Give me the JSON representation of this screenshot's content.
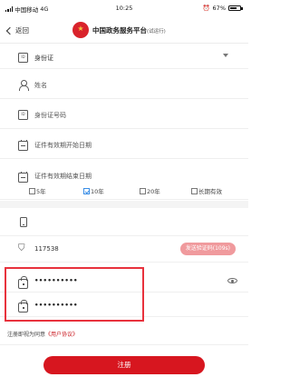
{
  "status_bar": {
    "carrier": "中国移动",
    "network": "4G",
    "time": "10:25",
    "battery": "67%"
  },
  "nav": {
    "back_label": "返回",
    "title": "中国政务服务平台",
    "title_suffix": "(试运行)"
  },
  "form": {
    "id_type": {
      "value": "身份证",
      "icon": "id-card-icon"
    },
    "name": {
      "placeholder": "姓名",
      "icon": "person-icon"
    },
    "id_number": {
      "placeholder": "身份证号码",
      "icon": "id-card-icon"
    },
    "valid_start": {
      "placeholder": "证件有效期开始日期",
      "icon": "calendar-icon"
    },
    "valid_end": {
      "placeholder": "证件有效期结束日期",
      "icon": "calendar-icon"
    },
    "validity_options": [
      {
        "label": "5年",
        "checked": false
      },
      {
        "label": "10年",
        "checked": true
      },
      {
        "label": "20年",
        "checked": false
      },
      {
        "label": "长期有效",
        "checked": false
      }
    ],
    "phone": {
      "placeholder": "",
      "icon": "phone-icon"
    },
    "sms_code": {
      "value": "117538",
      "button_label": "发送验证码(109s)",
      "icon": "shield-icon"
    },
    "password": {
      "value": "••••••••••",
      "icon": "lock-icon"
    },
    "confirm_password": {
      "value": "••••••••••",
      "icon": "lock-check-icon"
    },
    "agreement": {
      "prefix": "注册即视为同意",
      "link": "《用户协议》"
    },
    "submit_label": "注册"
  },
  "colors": {
    "brand_red": "#d7161f",
    "highlight_red": "#e8323d",
    "checkbox_blue": "#3a8ee6",
    "code_button": "#f09a9d"
  }
}
